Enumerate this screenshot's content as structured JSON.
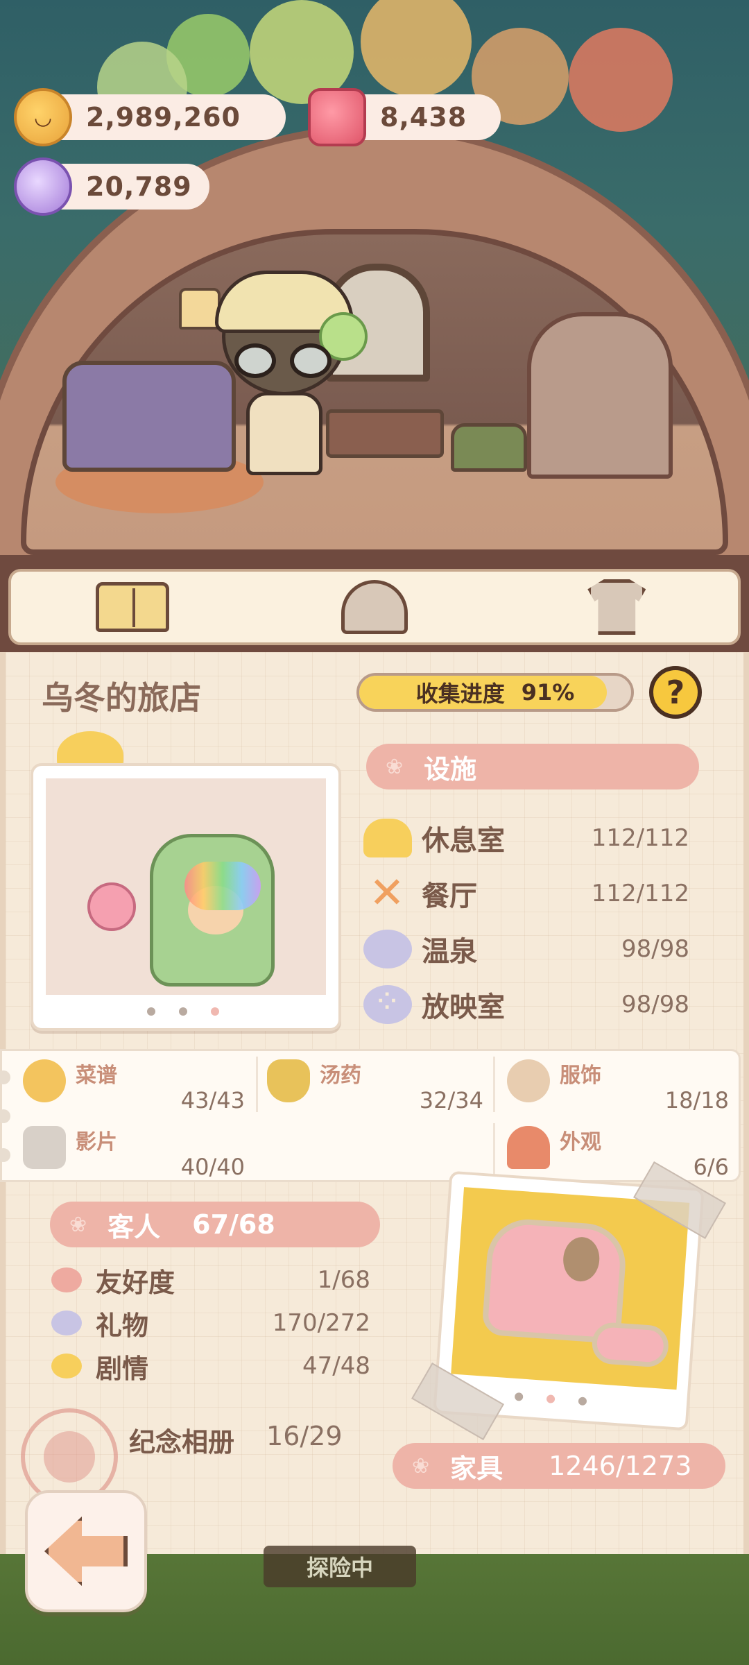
{
  "currencies": {
    "coins": "2,989,260",
    "jars": "8,438",
    "candies": "20,789"
  },
  "tabs": [
    {
      "icon": "book-icon"
    },
    {
      "icon": "hotel-icon"
    },
    {
      "icon": "shirt-icon"
    }
  ],
  "inn": {
    "title": "乌冬的旅店",
    "progress_label": "收集进度",
    "progress_value": "91%",
    "progress_fraction": 0.91,
    "help_label": "?"
  },
  "facilities": {
    "title": "设施",
    "items": [
      {
        "label": "休息室",
        "value": "112/112",
        "icon": "rest-room-icon"
      },
      {
        "label": "餐厅",
        "value": "112/112",
        "icon": "restaurant-icon"
      },
      {
        "label": "温泉",
        "value": "98/98",
        "icon": "hot-spring-icon"
      },
      {
        "label": "放映室",
        "value": "98/98",
        "icon": "cinema-icon"
      }
    ]
  },
  "collections": [
    {
      "label": "菜谱",
      "value": "43/43",
      "icon": "recipe-icon"
    },
    {
      "label": "汤药",
      "value": "32/34",
      "icon": "potion-icon"
    },
    {
      "label": "服饰",
      "value": "18/18",
      "icon": "outfit-icon"
    },
    {
      "label": "影片",
      "value": "40/40",
      "icon": "film-icon"
    },
    {
      "label": "外观",
      "value": "6/6",
      "icon": "exterior-icon"
    }
  ],
  "guests": {
    "title": "客人",
    "value": "67/68",
    "items": [
      {
        "label": "友好度",
        "value": "1/68",
        "icon": "heart-icon"
      },
      {
        "label": "礼物",
        "value": "170/272",
        "icon": "gift-heart-icon"
      },
      {
        "label": "剧情",
        "value": "47/48",
        "icon": "story-heart-icon"
      }
    ]
  },
  "album": {
    "label": "纪念相册",
    "value": "16/29"
  },
  "furniture": {
    "title": "家具",
    "value": "1246/1273"
  },
  "bottom_sign": "探险中"
}
